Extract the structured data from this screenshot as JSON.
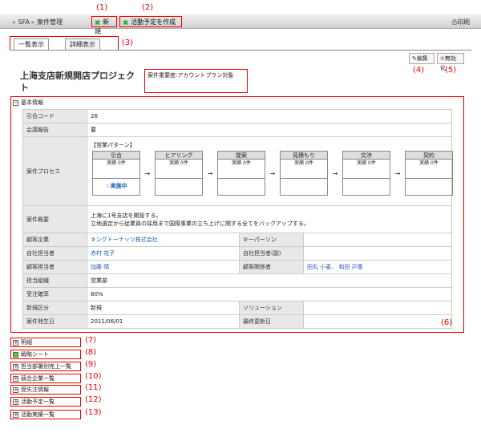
{
  "header": {
    "app_label": "SFA",
    "module_label": "案件管理",
    "new_label": "新規",
    "create_plan_label": "活動予定を作成",
    "print_label": "印刷"
  },
  "tabs": [
    {
      "label": "一覧表示"
    },
    {
      "label": "詳細表示"
    }
  ],
  "actions": {
    "edit_label": "編集",
    "disable_label": "無効化"
  },
  "title": "上海支店新規開店プロジェクト",
  "importance_text": "案件重要度:アカウントプラン対象",
  "basic_info": {
    "header": "基本情報",
    "fields": {
      "ref_code_label": "引合コード",
      "ref_code": "26",
      "meeting_label": "会議報告",
      "meeting": "要",
      "process_label": "案件プロセス",
      "pattern_label": "【営業パターン】",
      "summary_label": "案件概要",
      "summary_line1": "上海に1号支店を開設する。",
      "summary_line2": "立地選定から従業員の採用まで国際事業の立ち上げに関する全てをバックアップする。",
      "customer_label": "顧客企業",
      "customer": "キングドーナッツ株式会社",
      "keyperson_label": "キーパーソン",
      "keyperson": "",
      "owner_label": "自社担当者",
      "owner": "赤村 花子",
      "owner_sub_label": "自社担当者(副)",
      "owner_sub": "",
      "cust_contact_label": "顧客担当者",
      "cust_contact": "加藤 晴",
      "cust_rel_label": "顧客関係者",
      "cust_rel": "田丸 小麦、 和田 戸重",
      "dept_label": "担当組織",
      "dept": "営業部",
      "prob_label": "受注確率",
      "prob": "80%",
      "newtype_label": "新規区分",
      "newtype": "新規",
      "solution_label": "ソリューション",
      "solution": "",
      "date_label": "案件発生日",
      "date": "2011/06/01",
      "update_label": "最終更新日",
      "update": ""
    },
    "stages": [
      {
        "name": "引合",
        "record": "実績 0件",
        "footer": "☆実施中"
      },
      {
        "name": "ヒアリング",
        "record": "実績 0件",
        "footer": ""
      },
      {
        "name": "提案",
        "record": "実績 0件",
        "footer": ""
      },
      {
        "name": "見積もり",
        "record": "実績 0件",
        "footer": ""
      },
      {
        "name": "交渉",
        "record": "実績 0件",
        "footer": ""
      },
      {
        "name": "契約",
        "record": "実績 0件",
        "footer": ""
      }
    ]
  },
  "sections": [
    {
      "label": "明細"
    },
    {
      "label": "戦略シート"
    },
    {
      "label": "担当部署別売上一覧"
    },
    {
      "label": "競合企業一覧"
    },
    {
      "label": "受失注情報"
    },
    {
      "label": "活動予定一覧"
    },
    {
      "label": "活動実績一覧"
    }
  ],
  "annotations": {
    "a1": "(1)",
    "a2": "(2)",
    "a3": "(3)",
    "a4": "(4)",
    "a5": "(5)",
    "a6": "(6)",
    "a7": "(7)",
    "a8": "(8)",
    "a9": "(9)",
    "a10": "(10)",
    "a11": "(11)",
    "a12": "(12)",
    "a13": "(13)"
  }
}
